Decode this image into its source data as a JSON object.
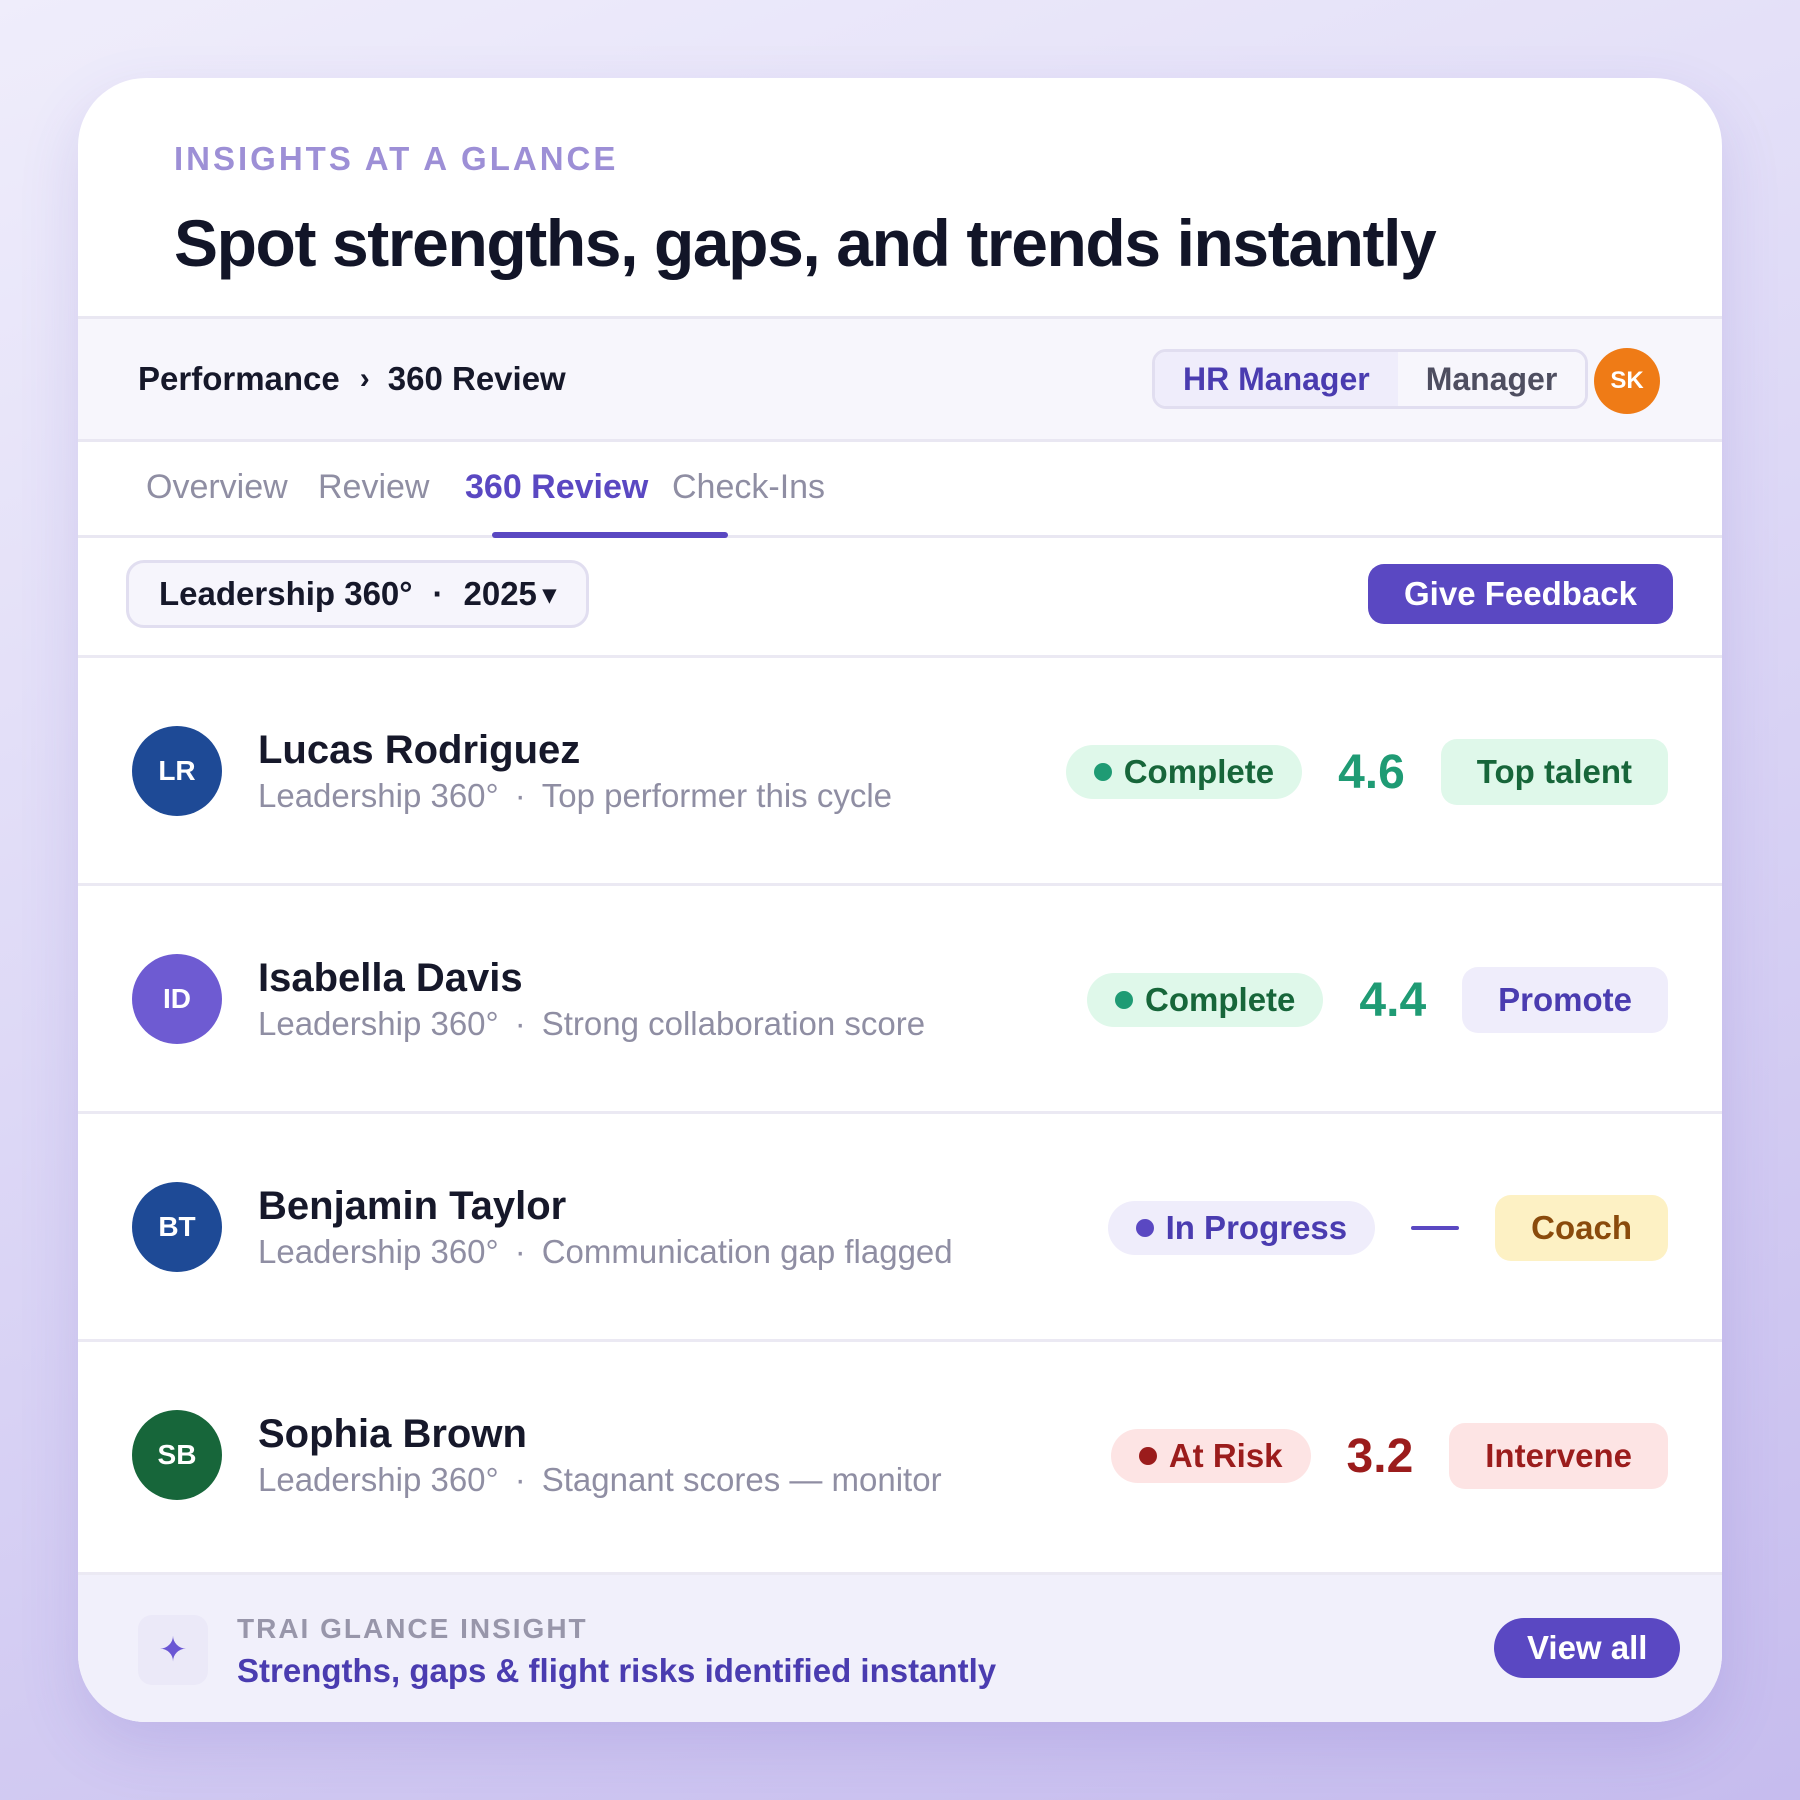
{
  "hero": {
    "eyebrow": "INSIGHTS AT A GLANCE",
    "headline": "Spot strengths, gaps, and trends instantly"
  },
  "breadcrumb": {
    "root": "Performance",
    "separator": "›",
    "current": "360 Review"
  },
  "roles": {
    "active": "HR Manager",
    "inactive": "Manager"
  },
  "user": {
    "initials": "SK",
    "color": "#ef7b16"
  },
  "tabs": [
    {
      "label": "Overview",
      "active": false
    },
    {
      "label": "Review",
      "active": false
    },
    {
      "label": "360 Review",
      "active": true
    },
    {
      "label": "Check-Ins",
      "active": false
    }
  ],
  "filter": {
    "cycle": "Leadership 360°",
    "separator": "·",
    "year": "2025",
    "caret": "▾"
  },
  "primary_action": "Give Feedback",
  "reviews": [
    {
      "initials": "LR",
      "avatar_color": "#1e4a96",
      "name": "Lucas Rodriguez",
      "program": "Leadership 360°",
      "note": "Top performer this cycle",
      "status": "Complete",
      "status_style": "complete",
      "score": "4.6",
      "score_color": "#1f9b74",
      "action": "Top talent",
      "action_style": "green"
    },
    {
      "initials": "ID",
      "avatar_color": "#6e5bd2",
      "name": "Isabella Davis",
      "program": "Leadership 360°",
      "note": "Strong collaboration score",
      "status": "Complete",
      "status_style": "complete",
      "score": "4.4",
      "score_color": "#1f9b74",
      "action": "Promote",
      "action_style": "purple"
    },
    {
      "initials": "BT",
      "avatar_color": "#1e4a96",
      "name": "Benjamin Taylor",
      "program": "Leadership 360°",
      "note": "Communication gap flagged",
      "status": "In Progress",
      "status_style": "progress",
      "score": "—",
      "score_color": "#5a48c2",
      "action": "Coach",
      "action_style": "yellow"
    },
    {
      "initials": "SB",
      "avatar_color": "#17663a",
      "name": "Sophia Brown",
      "program": "Leadership 360°",
      "note": "Stagnant scores — monitor",
      "status": "At Risk",
      "status_style": "risk",
      "score": "3.2",
      "score_color": "#9b1c1c",
      "action": "Intervene",
      "action_style": "red"
    }
  ],
  "footer": {
    "icon": "sparkle-icon",
    "eyebrow": "TRAI GLANCE INSIGHT",
    "text": "Strengths, gaps & flight risks identified instantly",
    "button": "View all"
  },
  "colors": {
    "accent": "#5a48c2",
    "complete_bg": "#dff8ea",
    "complete_fg": "#17663a",
    "complete_dot": "#1f9b74",
    "progress_bg": "#efedfb",
    "progress_fg": "#4a3cb0",
    "progress_dot": "#5a48c2",
    "risk_bg": "#fde4e4",
    "risk_fg": "#9b1c1c",
    "risk_dot": "#9b1c1c",
    "green_bg": "#dff8ea",
    "green_fg": "#17663a",
    "purple_bg": "#efedfb",
    "purple_fg": "#4a3cb0",
    "yellow_bg": "#fdf1c4",
    "yellow_fg": "#8a4b0c",
    "red_bg": "#fde4e4",
    "red_fg": "#9b1c1c"
  }
}
